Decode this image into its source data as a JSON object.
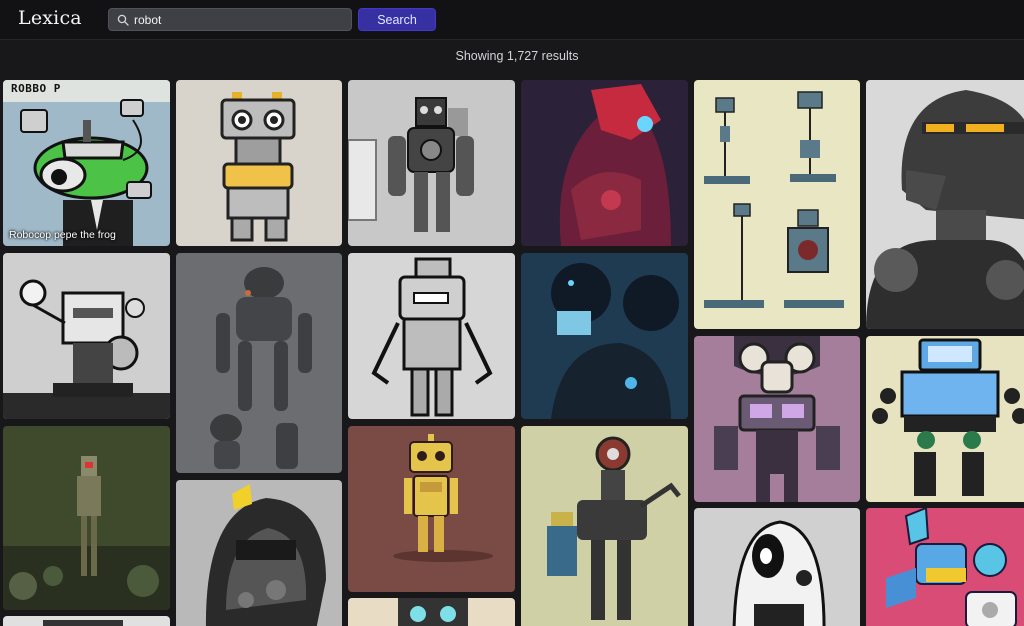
{
  "app": {
    "logo_text": "Lexica"
  },
  "search": {
    "query": "robot",
    "button_label": "Search"
  },
  "results": {
    "count_text": "Showing 1,727 results",
    "first_tile_caption": "Robocop pepe the frog",
    "first_tile_text": "ROBBO P"
  },
  "colors": {
    "topbar": "#121214",
    "background": "#18181b",
    "search_button": "#3730a3"
  }
}
